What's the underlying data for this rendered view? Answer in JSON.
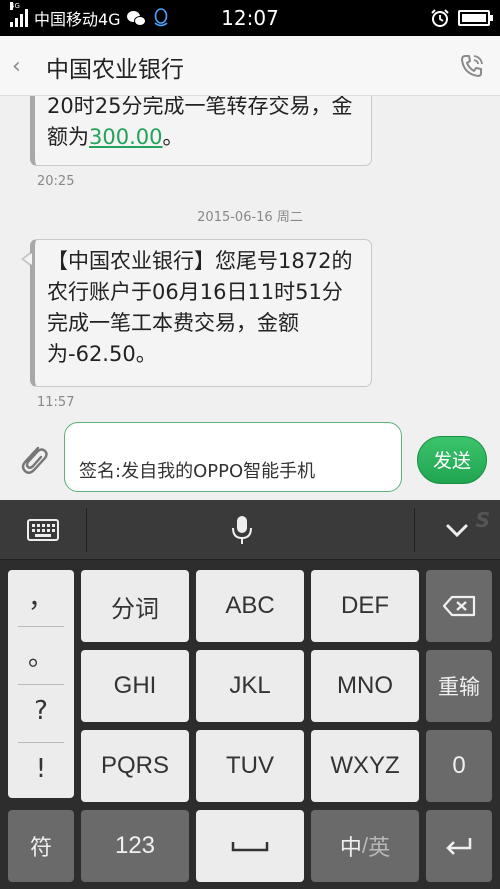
{
  "status_bar": {
    "network_tag": "4G",
    "carrier": "中国移动4G",
    "time": "12:07"
  },
  "header": {
    "back_symbol": "‹",
    "title": "中国农业银行"
  },
  "messages": [
    {
      "text_before": "20时25分完成一笔转存交易，金额为",
      "amount": "300.00",
      "text_after": "。",
      "time": "20:25"
    },
    {
      "text": "【中国农业银行】您尾号1872的农行账户于06月16日11时51分完成一笔工本费交易，金额为-62.50。",
      "time": "11:57"
    }
  ],
  "date_separator": "2015-06-16 周二",
  "composer": {
    "input_value": "签名:发自我的OPPO智能手机",
    "send_label": "发送"
  },
  "keyboard": {
    "punctuation": [
      "，",
      "。",
      "?",
      "!"
    ],
    "keys": {
      "fenci": "分词",
      "abc": "ABC",
      "def": "DEF",
      "ghi": "GHI",
      "jkl": "JKL",
      "mno": "MNO",
      "pqrs": "PQRS",
      "tuv": "TUV",
      "wxyz": "WXYZ",
      "reinput": "重输",
      "zero": "0",
      "symbols": "符",
      "numbers": "123",
      "lang_zh": "中",
      "lang_sep": "/",
      "lang_en": "英",
      "space_symbol": "␣",
      "enter_symbol": "↵"
    }
  },
  "icons": {
    "signal": "signal-bars-icon",
    "wechat": "wechat-icon",
    "qq": "qq-penguin-icon",
    "alarm": "alarm-clock-icon",
    "battery": "battery-icon",
    "back": "back-chevron-icon",
    "phone": "phone-call-icon",
    "attach": "paperclip-icon",
    "keyboard": "keyboard-icon",
    "mic": "microphone-icon",
    "collapse": "chevron-down-icon",
    "delete": "backspace-icon"
  },
  "colors": {
    "accent_green": "#21a35a",
    "send_button": "#20a450",
    "status_bar_bg": "#000000",
    "keyboard_bg": "#2d2d2d"
  }
}
